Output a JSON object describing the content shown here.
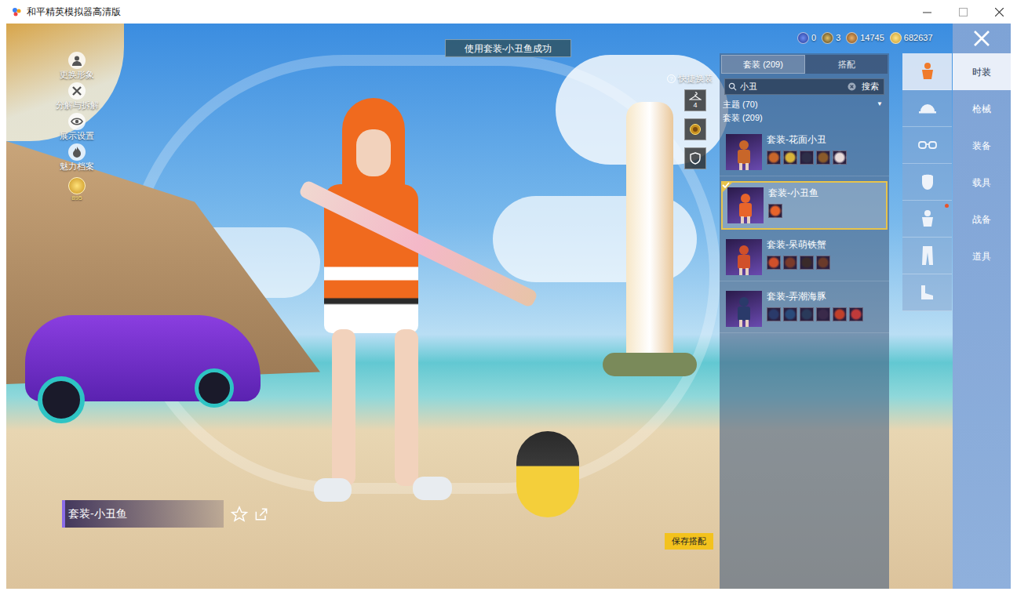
{
  "window": {
    "title": "和平精英模拟器高清版"
  },
  "toast": "使用套装-小丑鱼成功",
  "left_menu": [
    {
      "label": "更换形象",
      "kind": "person"
    },
    {
      "label": "分解与拆解",
      "kind": "tool"
    },
    {
      "label": "展示设置",
      "kind": "eye"
    },
    {
      "label": "魅力档案",
      "kind": "flame"
    }
  ],
  "charm_badge": "895",
  "currencies": [
    {
      "amount": "0",
      "kind": "globe"
    },
    {
      "amount": "3",
      "kind": "medal"
    },
    {
      "amount": "14745",
      "kind": "coin"
    },
    {
      "amount": "682637",
      "kind": "gold"
    }
  ],
  "quick_change": {
    "label": "快捷换装",
    "help": "?",
    "slots": [
      {
        "kind": "hanger",
        "count": "4"
      },
      {
        "kind": "emblem"
      },
      {
        "kind": "shield"
      }
    ]
  },
  "panel": {
    "tabs": [
      {
        "label": "套装 (209)",
        "selected": true
      },
      {
        "label": "搭配",
        "selected": false
      }
    ],
    "search": {
      "value": "小丑",
      "button": "搜索"
    },
    "filter": {
      "label": "主题 (70)",
      "arrow": "▼"
    },
    "section": "套装 (209)",
    "items": [
      {
        "name": "套装-花面小丑",
        "selected": false,
        "part_colors": [
          "#c8662a",
          "#d9b43a",
          "#2e2e48",
          "#8a5a2a",
          "#e8dada"
        ]
      },
      {
        "name": "套装-小丑鱼",
        "selected": true,
        "part_colors": [
          "#e8642a"
        ]
      },
      {
        "name": "套装-呆萌铁蟹",
        "selected": false,
        "part_colors": [
          "#d0502a",
          "#7a3a2a",
          "#3a2a2a",
          "#6a3a2a"
        ]
      },
      {
        "name": "套装-弄潮海豚",
        "selected": false,
        "part_colors": [
          "#2a3a6a",
          "#2a4a7a",
          "#2a3a5a",
          "#3a2a4a",
          "#c0402a",
          "#c03a3a"
        ]
      }
    ]
  },
  "icon_tabs": [
    {
      "kind": "outfit",
      "selected": true,
      "dot": false
    },
    {
      "kind": "hat",
      "selected": false,
      "dot": false
    },
    {
      "kind": "glasses",
      "selected": false,
      "dot": false
    },
    {
      "kind": "mask",
      "selected": false,
      "dot": false
    },
    {
      "kind": "outfit",
      "selected": false,
      "dot": true
    },
    {
      "kind": "pants",
      "selected": false,
      "dot": false
    },
    {
      "kind": "shoes",
      "selected": false,
      "dot": false
    }
  ],
  "categories": [
    {
      "label": "时装",
      "selected": true
    },
    {
      "label": "枪械",
      "selected": false
    },
    {
      "label": "装备",
      "selected": false
    },
    {
      "label": "载具",
      "selected": false
    },
    {
      "label": "战备",
      "selected": false
    },
    {
      "label": "道具",
      "selected": false
    }
  ],
  "outfit_name": "套装-小丑鱼",
  "save_button": "保存搭配"
}
